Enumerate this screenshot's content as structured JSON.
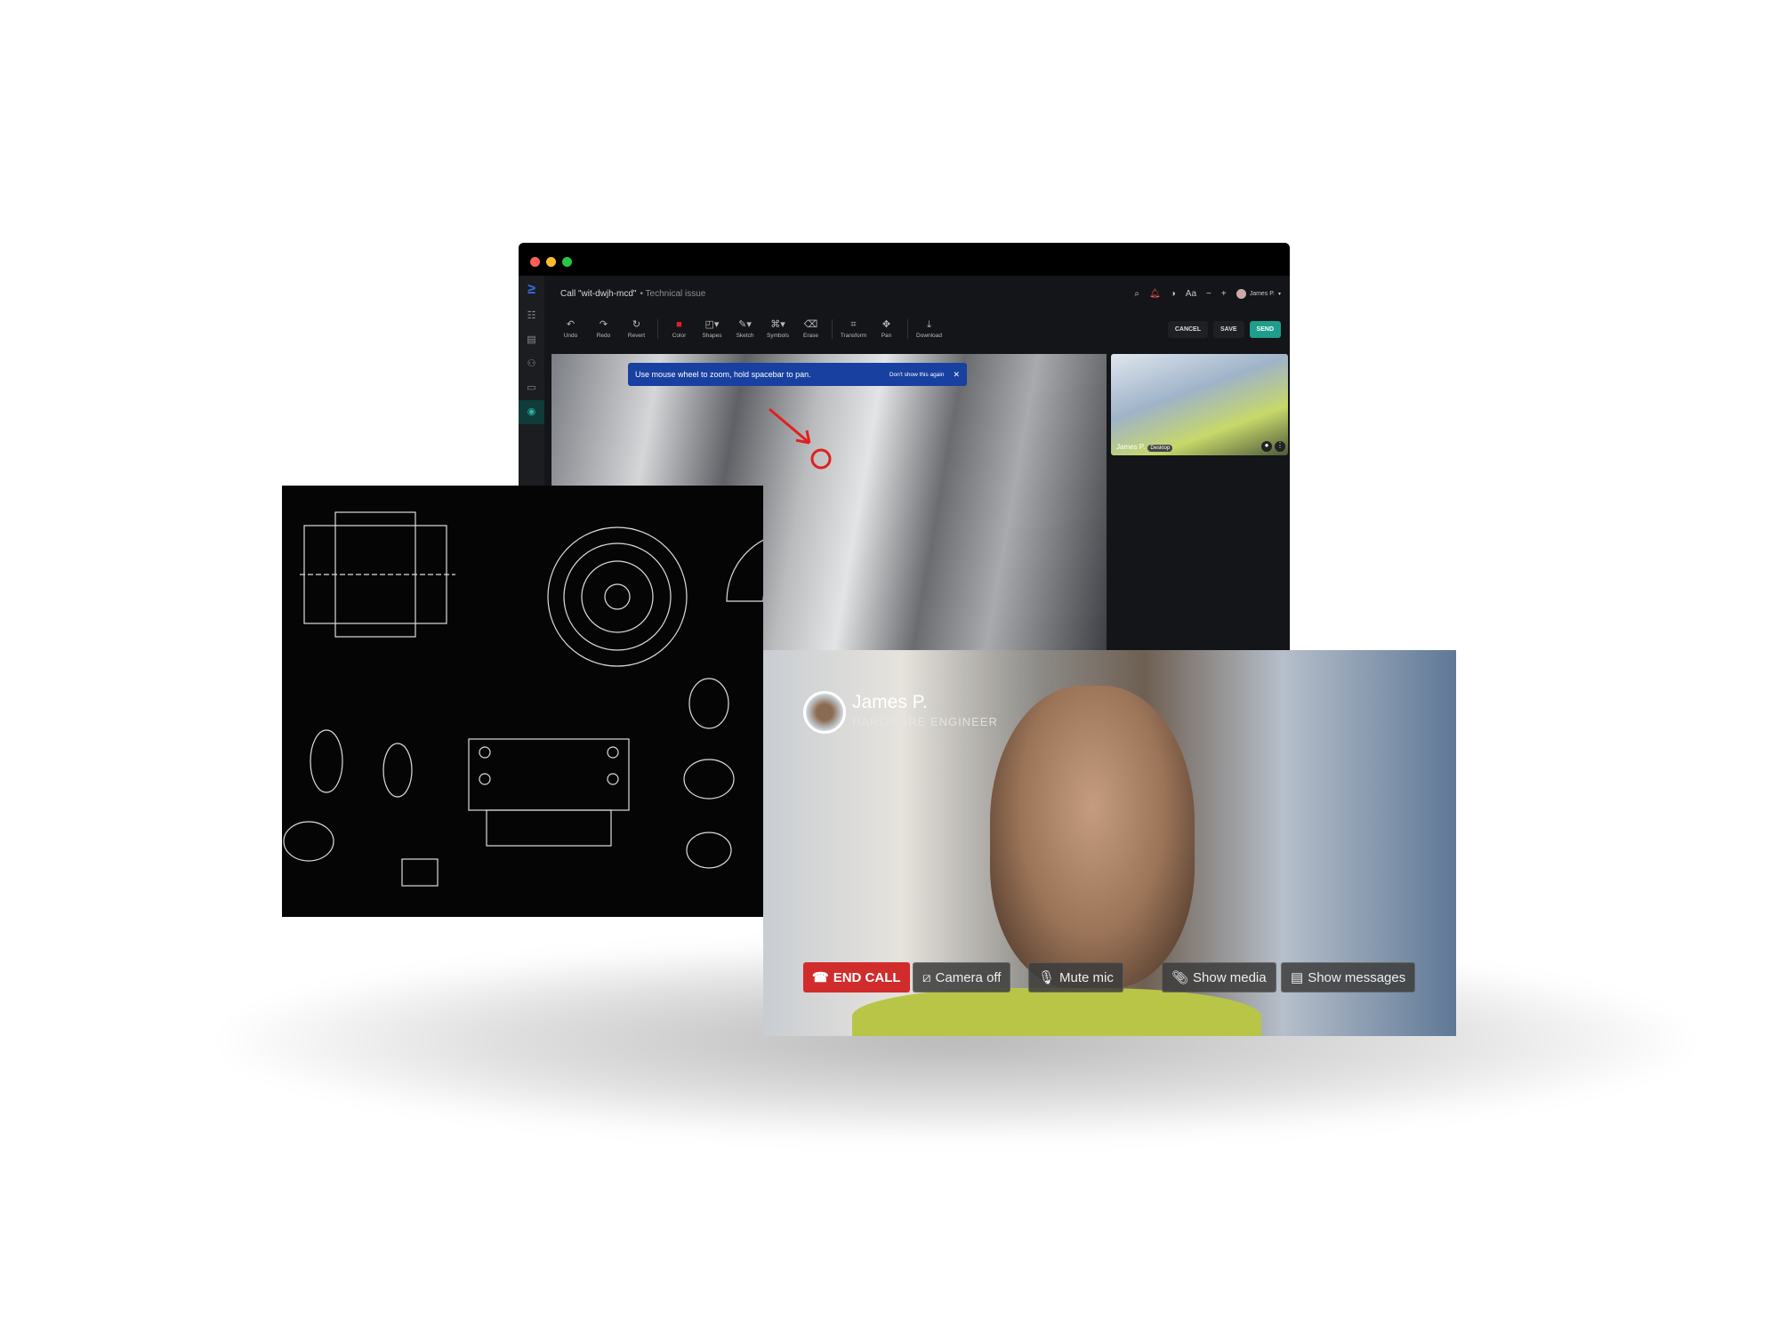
{
  "app": {
    "title": "Call \"wit-dwjh-mcd\"",
    "subtitle": "• Technical issue",
    "user": "James P.",
    "font_size_label": "Aa"
  },
  "toolbar": {
    "tools": [
      {
        "label": "Undo",
        "icon": "undo-icon",
        "glyph": "↶"
      },
      {
        "label": "Redo",
        "icon": "redo-icon",
        "glyph": "↷"
      },
      {
        "label": "Revert",
        "icon": "revert-icon",
        "glyph": "↻"
      },
      {
        "label": "Color",
        "icon": "color-swatch-icon",
        "glyph": "■"
      },
      {
        "label": "Shapes",
        "icon": "shapes-icon",
        "glyph": "◰▾"
      },
      {
        "label": "Sketch",
        "icon": "sketch-icon",
        "glyph": "✎▾"
      },
      {
        "label": "Symbols",
        "icon": "symbols-icon",
        "glyph": "⌘▾"
      },
      {
        "label": "Erase",
        "icon": "eraser-icon",
        "glyph": "⌫"
      },
      {
        "label": "Transform",
        "icon": "transform-icon",
        "glyph": "⌗"
      },
      {
        "label": "Pan",
        "icon": "pan-icon",
        "glyph": "✥"
      },
      {
        "label": "Download",
        "icon": "download-icon",
        "glyph": "⤓"
      }
    ],
    "cancel": "CANCEL",
    "save": "SAVE",
    "send": "SEND"
  },
  "banner": {
    "message": "Use mouse wheel to zoom, hold spacebar to pan.",
    "dismiss": "Don't show this again"
  },
  "thumbnail": {
    "name": "James P.",
    "tag": "Desktop"
  },
  "video": {
    "name": "James P.",
    "role": "HARDWARE ENGINEER",
    "buttons": {
      "end_call": "END CALL",
      "camera_off": "Camera off",
      "mute_mic": "Mute mic",
      "show_media": "Show media",
      "show_messages": "Show messages"
    }
  },
  "colors": {
    "accent": "#1e9e8c",
    "banner": "#1740a0",
    "end_call": "#d12c2c",
    "annotation": "#e02020"
  }
}
